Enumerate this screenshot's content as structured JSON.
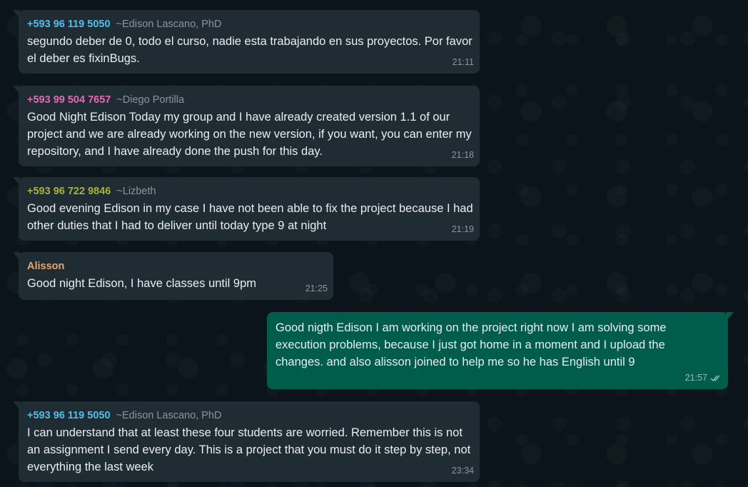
{
  "messages": [
    {
      "phone": "+593 96 119 5050",
      "name": "~Edison Lascano, PhD",
      "text": "segundo deber de 0, todo el curso, nadie esta trabajando en sus proyectos. Por favor el deber es fixinBugs.",
      "time": "21:11",
      "color": "#53bdeb"
    },
    {
      "phone": "+593 99 504 7657",
      "name": "~Diego Portilla",
      "text": "Good Night Edison Today my group and I have already created version 1.1 of our project and we are already working on the new version, if you want, you can enter my repository, and I have already done the push for this day.",
      "time": "21:18",
      "color": "#e26ab6"
    },
    {
      "phone": "+593 96 722 9846",
      "name": "~Lizbeth",
      "text": "Good evening Edison in my case I have not been able to fix the project because I had other duties that I had to deliver until today type 9 at night",
      "time": "21:19",
      "color": "#a5b337"
    },
    {
      "sender": "Alisson",
      "text": "Good night Edison, I have classes until 9pm",
      "time": "21:25",
      "color": "#e9a56b"
    },
    {
      "text": "Good nigth Edison I am working on the project right now I am solving some execution problems, because I just got home in a moment and I upload the changes. and also alisson joined to help me so he has English until 9",
      "time": "21:57"
    },
    {
      "phone": "+593 96 119 5050",
      "name": "~Edison Lascano, PhD",
      "text": "I can understand that at least these four students are worried. Remember this is not an assignment I send every day. This is a project that you must do it step by step, not everything the last week",
      "time": "23:34",
      "color": "#53bdeb"
    }
  ]
}
